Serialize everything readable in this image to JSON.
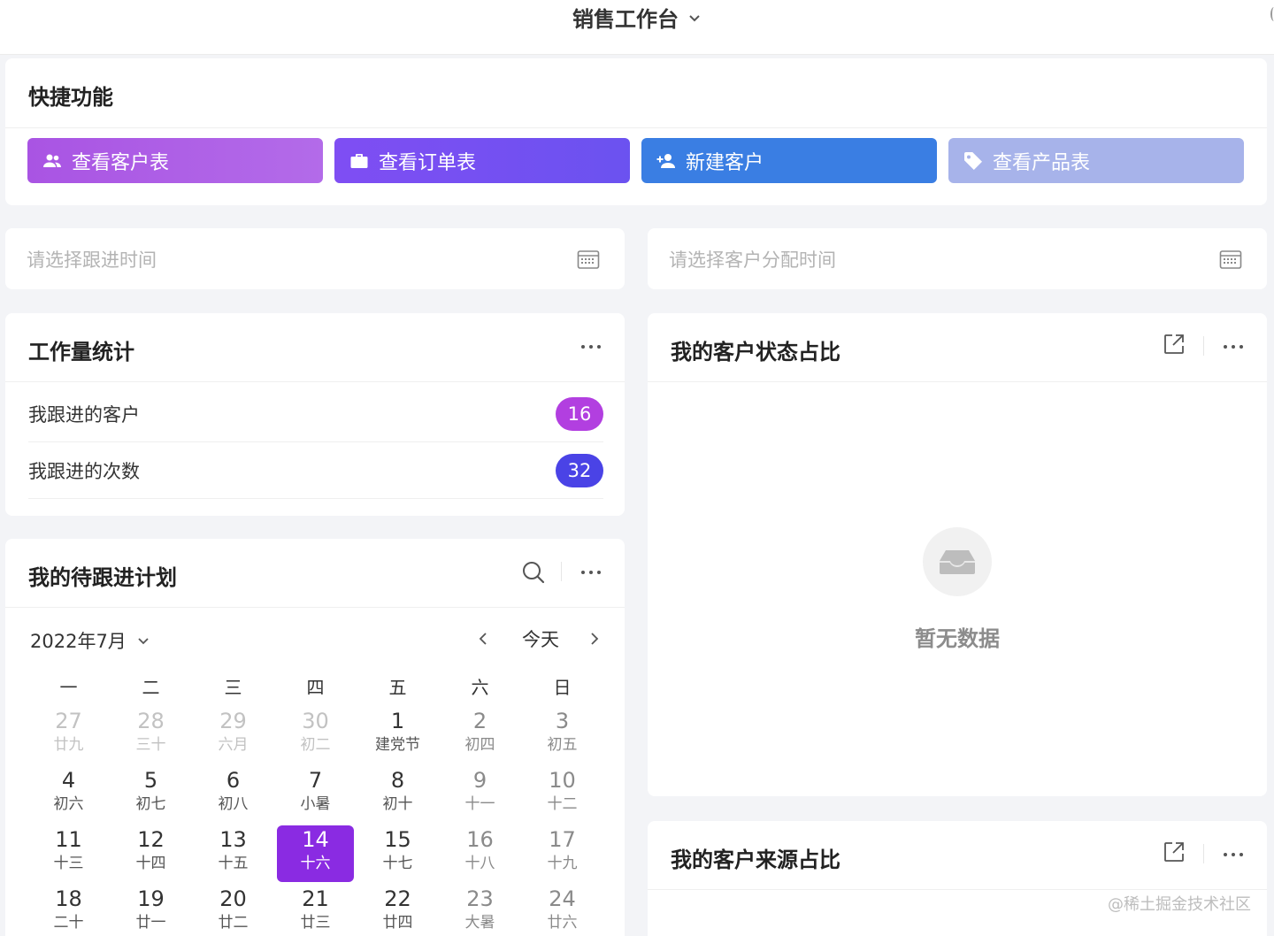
{
  "header": {
    "title": "销售工作台"
  },
  "quick": {
    "title": "快捷功能",
    "buttons": [
      {
        "label": "查看客户表",
        "icon": "people-icon",
        "color": "#a954e3"
      },
      {
        "label": "查看订单表",
        "icon": "briefcase-icon",
        "color": "#7f4ef3"
      },
      {
        "label": "新建客户",
        "icon": "add-person-icon",
        "color": "#3a7ee3"
      },
      {
        "label": "查看产品表",
        "icon": "tag-icon",
        "color": "#a7b3ea"
      }
    ]
  },
  "filters": {
    "follow_time_placeholder": "请选择跟进时间",
    "assign_time_placeholder": "请选择客户分配时间"
  },
  "workload": {
    "title": "工作量统计",
    "rows": [
      {
        "label": "我跟进的客户",
        "count": "16",
        "color": "#b23fe0"
      },
      {
        "label": "我跟进的次数",
        "count": "32",
        "color": "#4a43e6"
      }
    ]
  },
  "plan": {
    "title": "我的待跟进计划",
    "month": "2022年7月",
    "today": "今天",
    "weekdays": [
      "一",
      "二",
      "三",
      "四",
      "五",
      "六",
      "日"
    ],
    "days": [
      {
        "num": "27",
        "lunar": "廿九",
        "state": "other"
      },
      {
        "num": "28",
        "lunar": "三十",
        "state": "other"
      },
      {
        "num": "29",
        "lunar": "六月",
        "state": "other"
      },
      {
        "num": "30",
        "lunar": "初二",
        "state": "other"
      },
      {
        "num": "1",
        "lunar": "建党节",
        "state": "normal"
      },
      {
        "num": "2",
        "lunar": "初四",
        "state": "weekend"
      },
      {
        "num": "3",
        "lunar": "初五",
        "state": "weekend"
      },
      {
        "num": "4",
        "lunar": "初六",
        "state": "normal"
      },
      {
        "num": "5",
        "lunar": "初七",
        "state": "normal"
      },
      {
        "num": "6",
        "lunar": "初八",
        "state": "normal"
      },
      {
        "num": "7",
        "lunar": "小暑",
        "state": "normal"
      },
      {
        "num": "8",
        "lunar": "初十",
        "state": "normal"
      },
      {
        "num": "9",
        "lunar": "十一",
        "state": "weekend"
      },
      {
        "num": "10",
        "lunar": "十二",
        "state": "weekend"
      },
      {
        "num": "11",
        "lunar": "十三",
        "state": "normal"
      },
      {
        "num": "12",
        "lunar": "十四",
        "state": "normal"
      },
      {
        "num": "13",
        "lunar": "十五",
        "state": "normal"
      },
      {
        "num": "14",
        "lunar": "十六",
        "state": "selected"
      },
      {
        "num": "15",
        "lunar": "十七",
        "state": "normal"
      },
      {
        "num": "16",
        "lunar": "十八",
        "state": "weekend"
      },
      {
        "num": "17",
        "lunar": "十九",
        "state": "weekend"
      },
      {
        "num": "18",
        "lunar": "二十",
        "state": "normal"
      },
      {
        "num": "19",
        "lunar": "廿一",
        "state": "normal"
      },
      {
        "num": "20",
        "lunar": "廿二",
        "state": "normal"
      },
      {
        "num": "21",
        "lunar": "廿三",
        "state": "normal"
      },
      {
        "num": "22",
        "lunar": "廿四",
        "state": "normal"
      },
      {
        "num": "23",
        "lunar": "大暑",
        "state": "weekend"
      },
      {
        "num": "24",
        "lunar": "廿六",
        "state": "weekend"
      }
    ]
  },
  "status": {
    "title": "我的客户状态占比",
    "empty_text": "暂无数据"
  },
  "source": {
    "title": "我的客户来源占比"
  },
  "watermark": "@稀土掘金技术社区"
}
